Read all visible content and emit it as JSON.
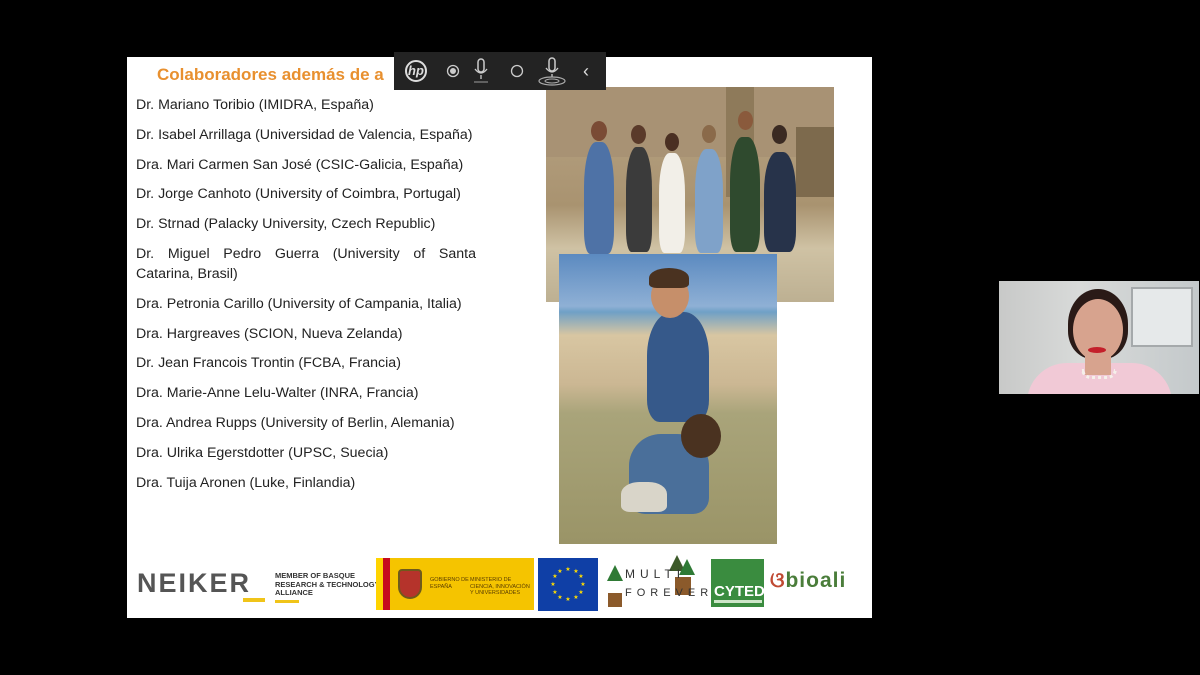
{
  "slide": {
    "title": "Colaboradores además de a",
    "collaborators": [
      "Dr. Mariano Toribio (IMIDRA, España)",
      "Dr. Isabel Arrillaga (Universidad de Valencia, España)",
      "Dra. Mari Carmen San José (CSIC-Galicia, España)",
      "Dr. Jorge Canhoto (University of Coimbra, Portugal)",
      "Dr. Strnad (Palacky University, Czech Republic)",
      "Dr. Miguel Pedro Guerra (University of Santa Catarina, Brasil)",
      "Dra. Petronia Carillo (University of Campania, Italia)",
      "Dra. Hargreaves (SCION, Nueva Zelanda)",
      "Dr. Jean Francois Trontin (FCBA, Francia)",
      "Dra. Marie-Anne Lelu-Walter (INRA, Francia)",
      "Dra. Andrea Rupps (University of Berlin, Alemania)",
      "Dra. Ulrika Egerstdotter (UPSC, Suecia)",
      "Dra. Tuija Aronen (Luke, Finlandia)"
    ],
    "logos": {
      "neiker": "NEIKER",
      "basque_alliance": "Member of Basque Research & Technology Alliance",
      "gov_1": "GOBIERNO DE ESPAÑA",
      "gov_2": "MINISTERIO DE CIENCIA, INNOVACIÓN Y UNIVERSIDADES",
      "multi_1": "MULTI",
      "multi_2": "FOREVER",
      "cyted": "CYTED",
      "bioali": "bioali"
    }
  },
  "toolbar": {
    "brand": "hp",
    "back_icon": "‹"
  },
  "colors": {
    "title_accent": "#e8902f",
    "toolbar_bg": "#232323",
    "background": "#000000"
  },
  "icons": {
    "toolbar": [
      "hp-logo-icon",
      "record-icon",
      "microphone-icon",
      "circle-icon",
      "microphone-wave-icon",
      "back-chevron-icon"
    ]
  }
}
